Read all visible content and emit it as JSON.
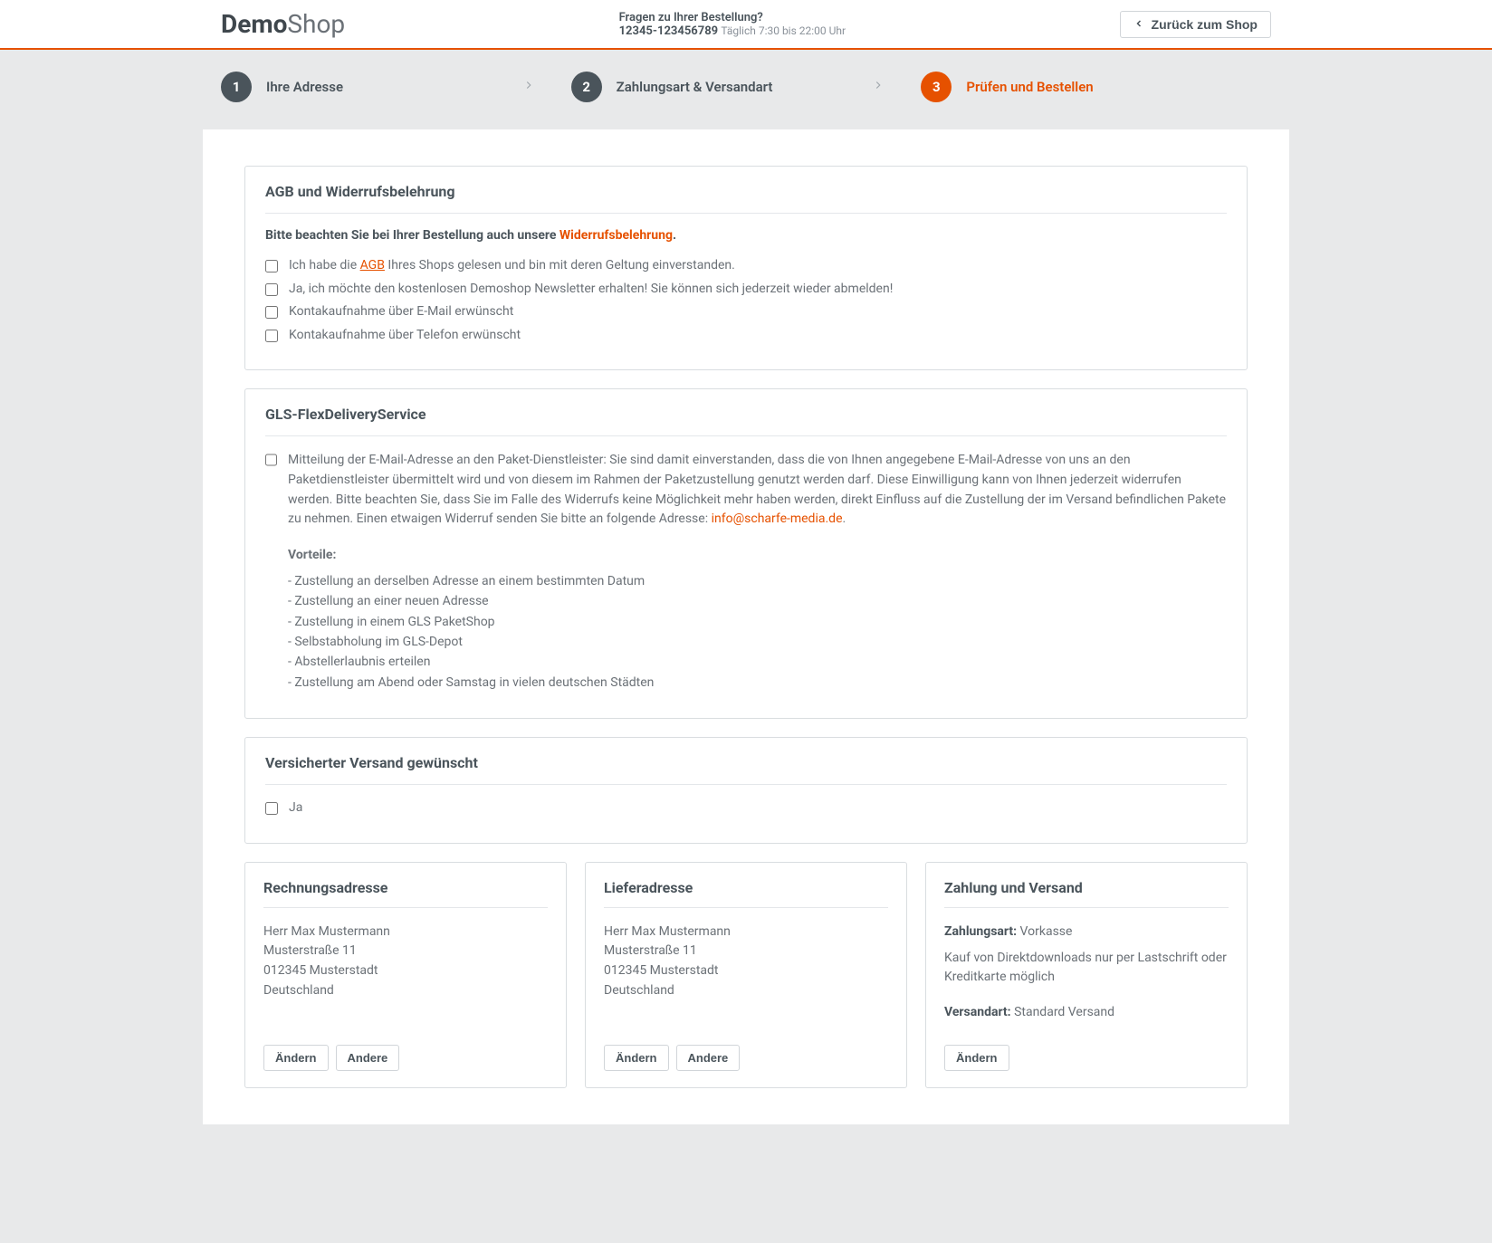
{
  "header": {
    "logo_bold": "Demo",
    "logo_light": "Shop",
    "question_title": "Fragen zu Ihrer Bestellung?",
    "phone": "12345-123456789",
    "hours": "Täglich 7:30 bis 22:00 Uhr",
    "back_label": "Zurück zum Shop"
  },
  "steps": {
    "s1": {
      "num": "1",
      "label": "Ihre Adresse"
    },
    "s2": {
      "num": "2",
      "label": "Zahlungsart & Versandart"
    },
    "s3": {
      "num": "3",
      "label": "Prüfen und Bestellen"
    }
  },
  "agbPanel": {
    "title": "AGB und Widerrufsbelehrung",
    "notice_prefix": "Bitte beachten Sie bei Ihrer Bestellung auch unsere ",
    "notice_link": "Widerrufsbelehrung",
    "notice_suffix": ".",
    "row1_pre": "Ich habe die ",
    "row1_link": "AGB",
    "row1_post": " Ihres Shops gelesen und bin mit deren Geltung einverstanden.",
    "row2": "Ja, ich möchte den kostenlosen Demoshop Newsletter erhalten! Sie können sich jederzeit wieder abmelden!",
    "row3": "Kontakaufnahme über E-Mail erwünscht",
    "row4": "Kontakaufnahme über Telefon erwünscht"
  },
  "flexPanel": {
    "title": "GLS-FlexDeliveryService",
    "body_pre": "Mitteilung der E-Mail-Adresse an den Paket-Dienstleister: Sie sind damit einverstanden, dass die von Ihnen angegebene E-Mail-Adresse von uns an den Paketdienstleister übermittelt wird und von diesem im Rahmen der Paketzustellung genutzt werden darf. Diese Einwilligung kann von Ihnen jederzeit widerrufen werden. Bitte beachten Sie, dass Sie im Falle des Widerrufs keine Möglichkeit mehr haben werden, direkt Einfluss auf die Zustellung der im Versand befindlichen Pakete zu nehmen. Einen etwaigen Widerruf senden Sie bitte an folgende Adresse: ",
    "body_link": "info@scharfe-media.de",
    "body_post": ".",
    "vorteile_title": "Vorteile:",
    "v1": "- Zustellung an derselben Adresse an einem bestimmten Datum",
    "v2": "- Zustellung an einer neuen Adresse",
    "v3": "- Zustellung in einem GLS PaketShop",
    "v4": "- Selbstabholung im GLS-Depot",
    "v5": "- Abstellerlaubnis erteilen",
    "v6": "- Zustellung am Abend oder Samstag in vielen deutschen Städten"
  },
  "insuredPanel": {
    "title": "Versicherter Versand gewünscht",
    "yes": "Ja"
  },
  "billing": {
    "title": "Rechnungsadresse",
    "line1": "Herr Max Mustermann",
    "line2": "Musterstraße 11",
    "line3": "012345 Musterstadt",
    "line4": "Deutschland",
    "btn1": "Ändern",
    "btn2": "Andere"
  },
  "shipping": {
    "title": "Lieferadresse",
    "line1": "Herr Max Mustermann",
    "line2": "Musterstraße 11",
    "line3": "012345 Musterstadt",
    "line4": "Deutschland",
    "btn1": "Ändern",
    "btn2": "Andere"
  },
  "payment": {
    "title": "Zahlung und Versand",
    "pay_label": "Zahlungsart:",
    "pay_value": " Vorkasse",
    "note": "Kauf von Direktdownloads nur per Lastschrift oder Kreditkarte möglich",
    "ship_label": "Versandart:",
    "ship_value": " Standard Versand",
    "btn1": "Ändern"
  }
}
